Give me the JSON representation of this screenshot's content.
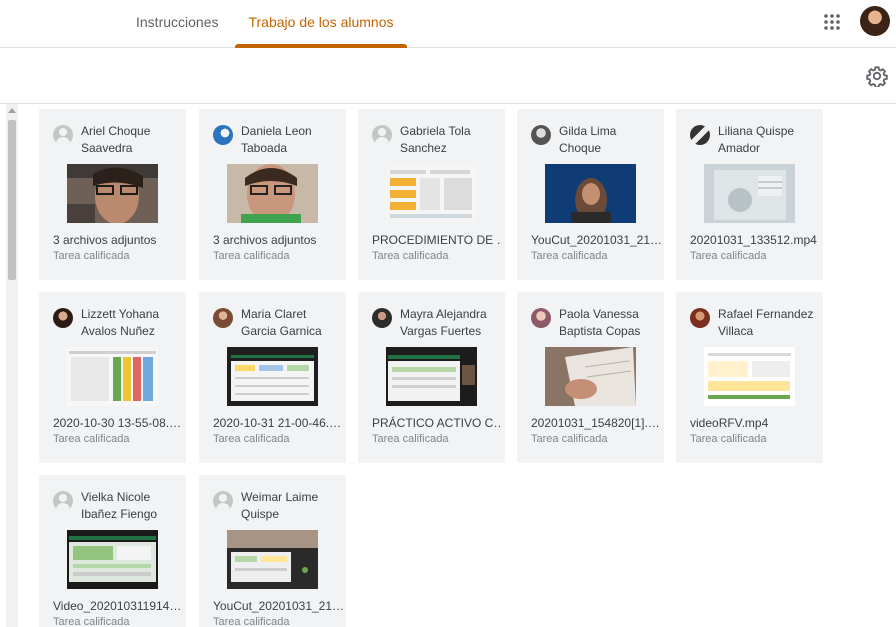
{
  "tabs": [
    {
      "label": "Instrucciones"
    },
    {
      "label": "Trabajo de los alumnos"
    }
  ],
  "colors": {
    "accent": "#c26401",
    "card_bg": "#f1f3f4",
    "status_text": "#80868b"
  },
  "icons": {
    "apps": "apps-grid-icon",
    "settings": "gear-icon",
    "profile": "user-avatar"
  },
  "students": [
    {
      "name": "Ariel Choque Saavedra",
      "file": "3 archivos adjuntos",
      "status": "Tarea calificada"
    },
    {
      "name": "Daniela Leon Taboada",
      "file": "3 archivos adjuntos",
      "status": "Tarea calificada"
    },
    {
      "name": "Gabriela Tola Sanchez",
      "file": "PROCEDIMIENTO DE …",
      "status": "Tarea calificada"
    },
    {
      "name": "Gilda Lima Choque",
      "file": "YouCut_20201031_21…",
      "status": "Tarea calificada"
    },
    {
      "name": "Liliana Quispe Amador",
      "file": "20201031_133512.mp4",
      "status": "Tarea calificada"
    },
    {
      "name": "Lizzett Yohana Avalos Nuñez",
      "file": "2020-10-30 13-55-08.…",
      "status": "Tarea calificada"
    },
    {
      "name": "Maria Claret Garcia Garnica",
      "file": "2020-10-31 21-00-46.…",
      "status": "Tarea calificada"
    },
    {
      "name": "Mayra Alejandra Vargas Fuertes",
      "file": "PRÁCTICO ACTIVO C…",
      "status": "Tarea calificada"
    },
    {
      "name": "Paola Vanessa Baptista Copas",
      "file": "20201031_154820[1].…",
      "status": "Tarea calificada"
    },
    {
      "name": "Rafael Fernandez Villaca",
      "file": "videoRFV.mp4",
      "status": "Tarea calificada"
    },
    {
      "name": "Vielka Nicole Ibañez Fiengo",
      "file": "Video_202010311914…",
      "status": "Tarea calificada"
    },
    {
      "name": "Weimar Laime Quispe",
      "file": "YouCut_20201031_21…",
      "status": "Tarea calificada"
    }
  ]
}
